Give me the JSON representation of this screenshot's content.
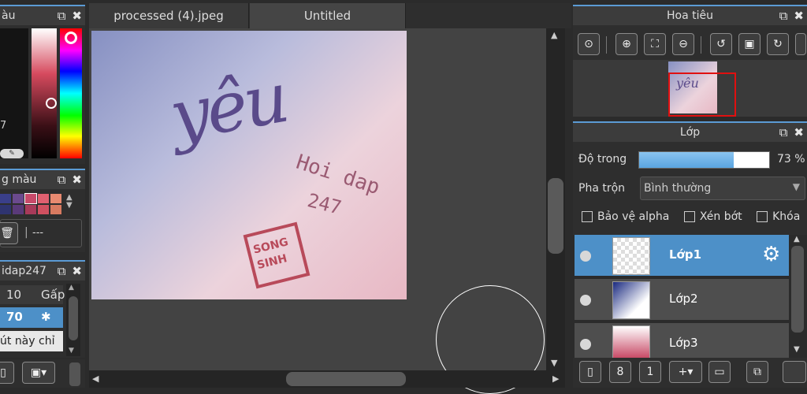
{
  "left_panels": {
    "color_panel": {
      "title": "àu",
      "value_label": "7"
    },
    "swatch_panel": {
      "title": "g màu",
      "trash_value": "---"
    },
    "brush_panel": {
      "title": "idap247",
      "row1_value": "10",
      "row1_label": "Gấp",
      "row2_value": "70",
      "note": "út này chỉ"
    }
  },
  "tabs": [
    {
      "label": "processed (4).jpeg",
      "active": false
    },
    {
      "label": "Untitled",
      "active": true
    }
  ],
  "canvas": {
    "text_main": "yêu",
    "text_sub1": "Hoi dap",
    "text_sub2": "247",
    "stamp_line1": "SONG",
    "stamp_line2": "SINH"
  },
  "navigator": {
    "title": "Hoa tiêu"
  },
  "layers_panel": {
    "title": "Lớp",
    "opacity_label": "Độ trong",
    "opacity_value": "73 %",
    "opacity": 0.73,
    "blend_label": "Pha trộn",
    "blend_value": "Bình thường",
    "protect_alpha": "Bảo vệ alpha",
    "clipping": "Xén bớt",
    "lock": "Khóa",
    "layers": [
      {
        "name": "Lớp1",
        "selected": true
      },
      {
        "name": "Lớp2",
        "selected": false
      },
      {
        "name": "Lớp3",
        "selected": false
      }
    ]
  },
  "colors": {
    "accent": "#5b9bd5",
    "selected_layer": "#4d90c8"
  }
}
